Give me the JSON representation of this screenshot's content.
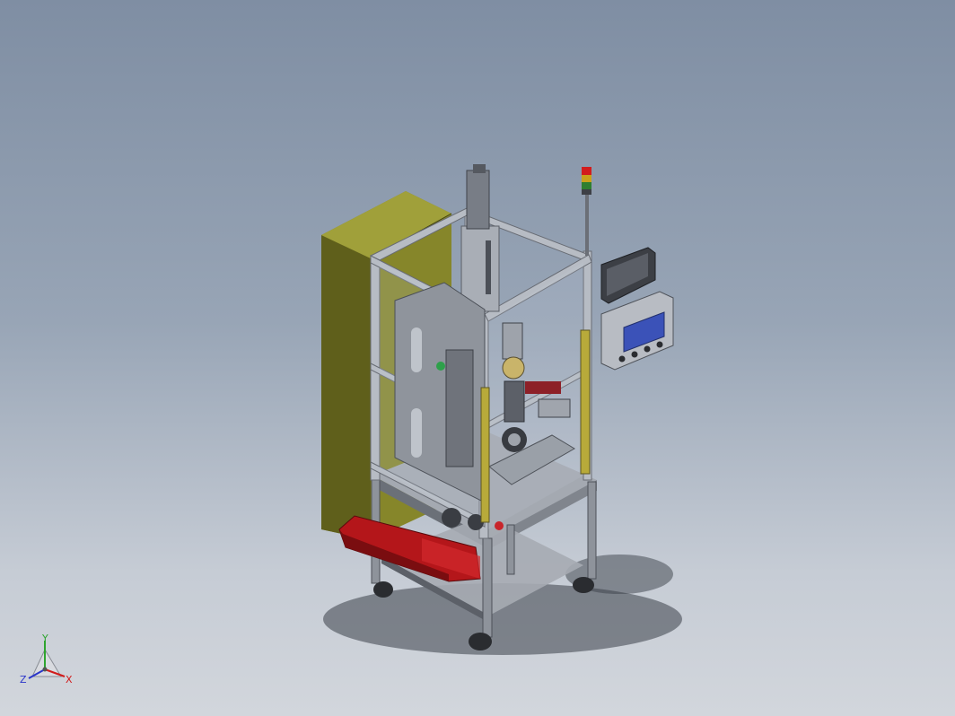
{
  "viewport": {
    "background_top": "#7f8ea3",
    "background_bottom": "#d2d6dc",
    "model": "machine-assembly-isometric"
  },
  "colors": {
    "frame": "#b9bec6",
    "frame_dark": "#6c7079",
    "cabinet": "#8a8a28",
    "cabinet_dark": "#5e5e1a",
    "guard_red": "#b4161a",
    "hmi_screen": "#3b52b8",
    "beacon_red": "#d21d1d",
    "beacon_amber": "#c9a21b",
    "beacon_green": "#2f7f30"
  },
  "triad": {
    "x_label": "X",
    "y_label": "Y",
    "z_label": "Z",
    "x_color": "#d11b1b",
    "y_color": "#2fa52f",
    "z_color": "#2a35c9"
  },
  "icons": [
    "coordinate-triad-icon"
  ]
}
